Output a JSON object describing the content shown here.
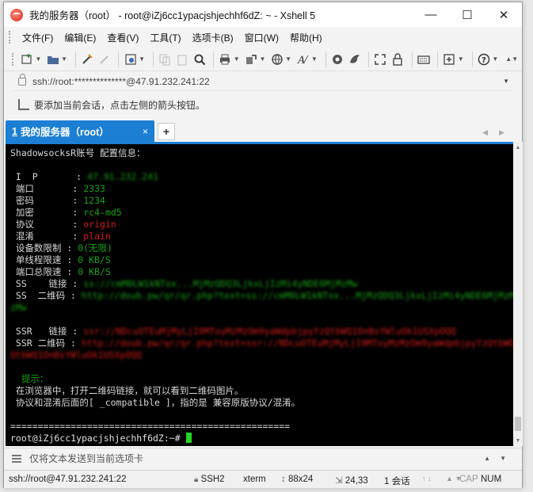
{
  "window": {
    "title": "我的服务器（root） - root@iZj6cc1ypacjshjechhf6dZ: ~ - Xshell 5",
    "controls": {
      "minimize": "—",
      "maximize": "☐",
      "close": "✕"
    }
  },
  "menu": {
    "items": [
      "文件(F)",
      "编辑(E)",
      "查看(V)",
      "工具(T)",
      "选项卡(B)",
      "窗口(W)",
      "帮助(H)"
    ]
  },
  "toolbar": {
    "icons": [
      "new-session-icon",
      "open-folder-icon",
      "reconnect-icon",
      "disconnect-icon",
      "properties-icon",
      "copy-icon",
      "paste-icon",
      "find-icon",
      "print-icon",
      "transfer-icon",
      "globe-icon",
      "font-icon",
      "xftp-icon",
      "xmanager-icon",
      "fullscreen-icon",
      "lock-icon",
      "keyboard-icon",
      "add-tab-icon",
      "help-icon"
    ]
  },
  "address": {
    "text": "ssh://root:**************@47.91.232.241:22"
  },
  "hint": {
    "text": "要添加当前会话，点击左侧的箭头按钮。"
  },
  "tabs": [
    {
      "number": "1",
      "label": "我的服务器（root）",
      "close": "×"
    }
  ],
  "terminal": {
    "header": "ShadowsocksR账号 配置信息：",
    "rows": [
      {
        "label": " I  P       : ",
        "value": "47.91.232.241",
        "color": "green",
        "blurred": true
      },
      {
        "label": " 端口       : ",
        "value": "2333",
        "color": "green",
        "blurred": false
      },
      {
        "label": " 密码       : ",
        "value": "1234",
        "color": "green",
        "blurred": false
      },
      {
        "label": " 加密       : ",
        "value": "rc4-md5",
        "color": "green",
        "blurred": false
      },
      {
        "label": " 协议       : ",
        "value": "origin",
        "color": "red",
        "blurred": false
      },
      {
        "label": " 混淆       : ",
        "value": "plain",
        "color": "red",
        "blurred": false
      },
      {
        "label": " 设备数限制 : ",
        "value": "0(无限)",
        "color": "green",
        "blurred": false
      },
      {
        "label": " 单线程限速 : ",
        "value": "0 KB/S",
        "color": "green",
        "blurred": false
      },
      {
        "label": " 端口总限速 : ",
        "value": "0 KB/S",
        "color": "green",
        "blurred": false
      }
    ],
    "ss_link_label": " SS    链接 : ",
    "ss_link": "ss://cmM0LW1kNTox...MjMzQDQ3LjkxLjIzMi4yNDE6MjMzMw",
    "ss_qr_label": " SS  二维码 : ",
    "ss_qr": "http://doub.pw/qr/qr.php?text=ss://cmM0LW1kNTox...MjMzQDQ3LjkxLjIzMi4yNDE6MjMzMw",
    "ss_qr_wrap": "zMw",
    "ssr_link_label": " SSR   链接 : ",
    "ssr_link": "ssr://NDcuOTEuMjMyLjI0MToyMzMzOm9yaWdpbjpyYzQtbWQ1OnBsYWluOk1USXpOQQ",
    "ssr_qr_label": " SSR 二维码 : ",
    "ssr_qr": "http://doub.pw/qr/qr.php?text=ssr://NDcuOTEuMjMyLjI0MToyMzMzOm9yaWdpbjpyYzQtbWQ1OnBsYWluOk1U",
    "ssr_qr_wrap": "QtbWQ1OnBsYWluOk1USXpOQQ",
    "tip_title": "  提示：",
    "tip_line1": " 在浏览器中，打开二维码链接，就可以看到二维码图片。",
    "tip_line2": " 协议和混淆后面的[ _compatible ]，指的是 兼容原版协议/混淆。",
    "separator": "===================================================",
    "prompt": "root@iZj6cc1ypacjshjechhf6dZ:~# "
  },
  "compose": {
    "placeholder": "仅将文本发送到当前选项卡"
  },
  "status": {
    "connection": "ssh://root@47.91.232.241:22",
    "protocol": "SSH2",
    "term": "xterm",
    "size": "88x24",
    "cursor": "24,33",
    "sessions": "1 会话",
    "cap": "CAP",
    "num": "NUM"
  },
  "colors": {
    "tab_accent": "#1c7fd3",
    "term_green": "#18a118",
    "term_red": "#d11a1a",
    "cursor": "#25d425"
  }
}
